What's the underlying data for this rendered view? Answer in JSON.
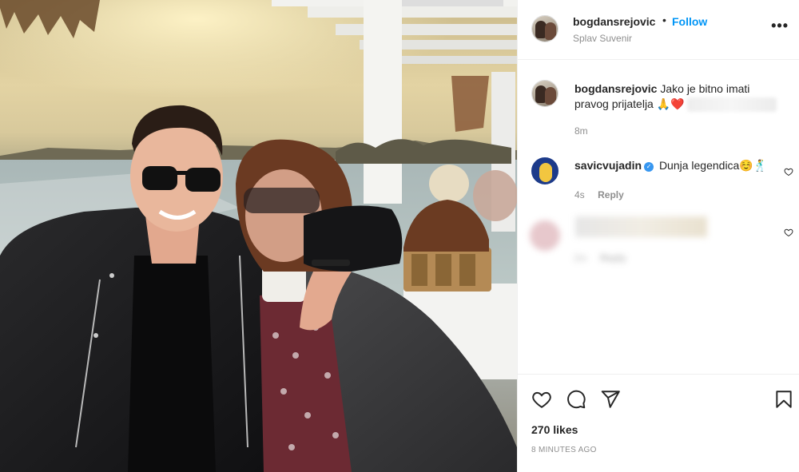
{
  "post": {
    "image_alt": "Two people sitting at a riverside restaurant at sunset",
    "author": {
      "username": "bogdansrejovic",
      "separator": "•",
      "follow_label": "Follow",
      "location": "Splav Suvenir"
    },
    "more_label": "•••",
    "caption": {
      "username": "bogdansrejovic",
      "text": "Jako je bitno imati pravog prijatelja 🙏❤️",
      "time": "8m"
    },
    "comments": [
      {
        "username": "savicvujadin",
        "verified": true,
        "text": "Dunja legendica☺️🕺",
        "time": "4s",
        "reply_label": "Reply"
      },
      {
        "username": "",
        "text": "",
        "time": "2m",
        "reply_label": "Reply",
        "blurred": true
      }
    ],
    "likes": "270 likes",
    "time_ago": "8 MINUTES AGO"
  },
  "icons": {
    "like": "heart-icon",
    "comment": "comment-icon",
    "share": "share-icon",
    "save": "bookmark-icon",
    "more": "more-options-icon"
  },
  "colors": {
    "link": "#0095f6",
    "muted": "#8e8e8e",
    "text": "#262626",
    "verified": "#3897f0",
    "divider": "#efefef"
  }
}
